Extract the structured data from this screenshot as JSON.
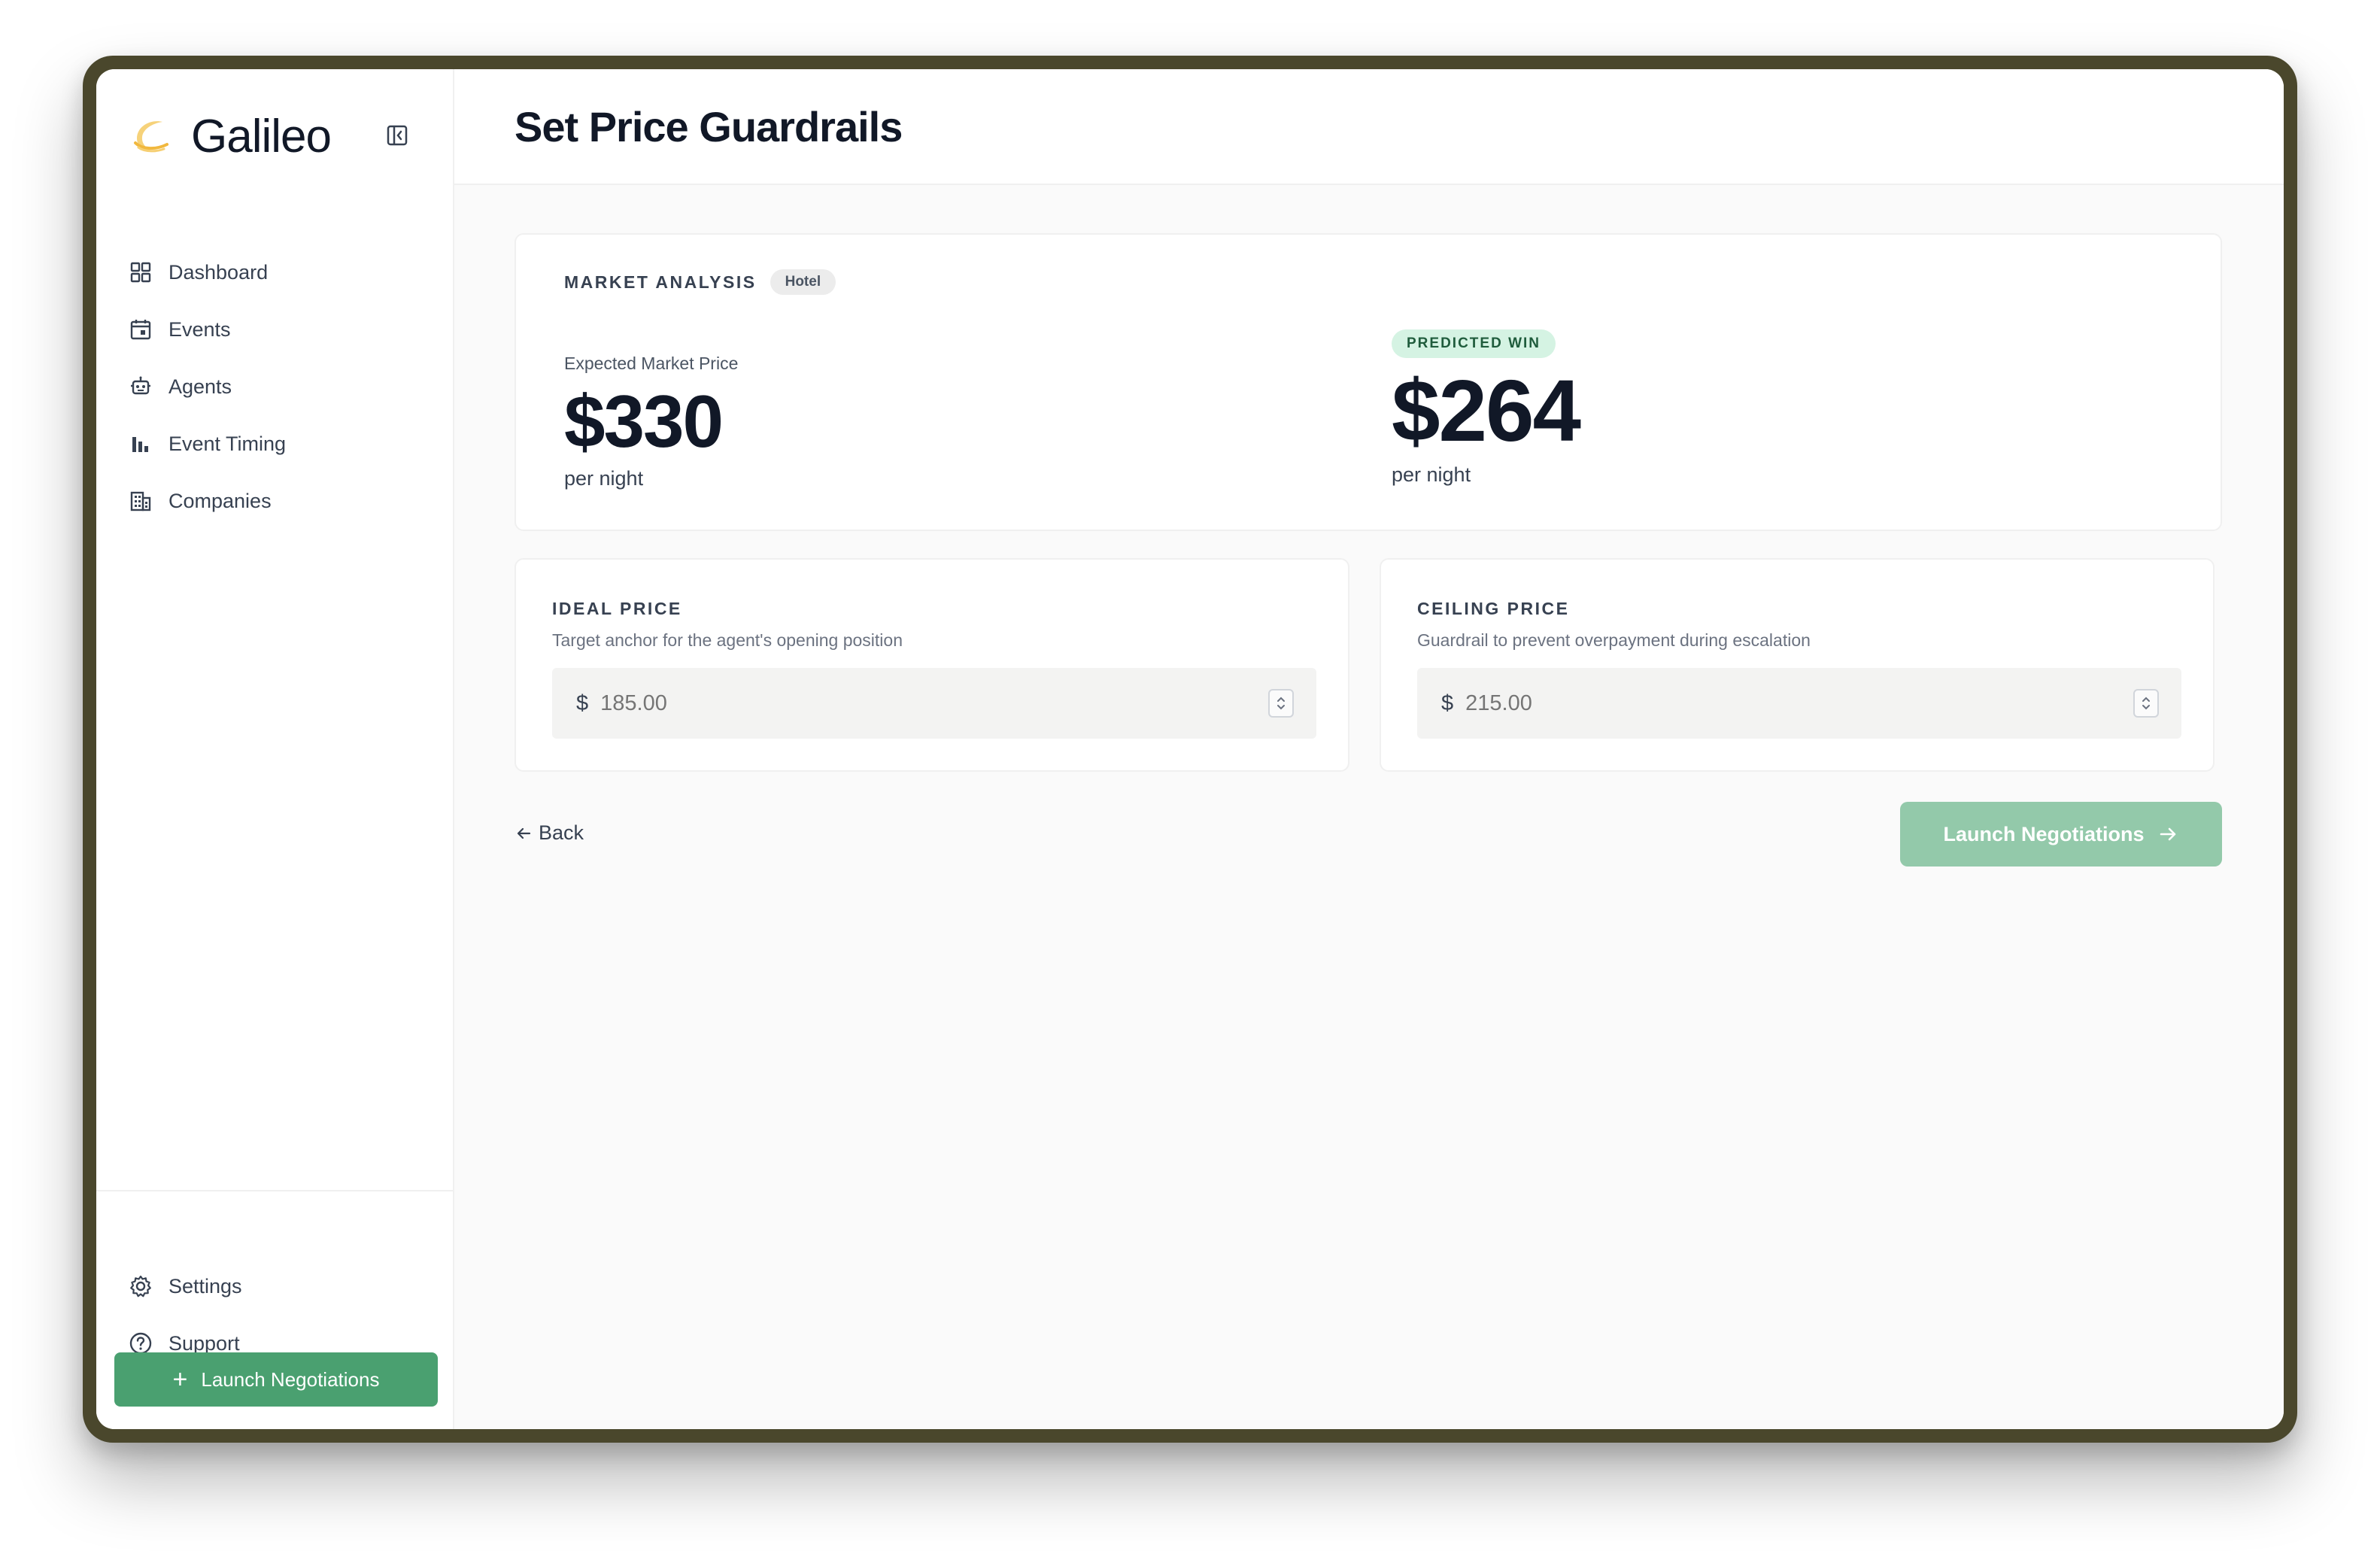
{
  "app": {
    "name": "Galileo"
  },
  "sidebar": {
    "items": [
      {
        "label": "Dashboard",
        "icon": "grid-icon"
      },
      {
        "label": "Events",
        "icon": "calendar-icon"
      },
      {
        "label": "Agents",
        "icon": "robot-icon"
      },
      {
        "label": "Event Timing",
        "icon": "bar-chart-icon"
      },
      {
        "label": "Companies",
        "icon": "building-icon"
      }
    ],
    "bottom_items": [
      {
        "label": "Settings",
        "icon": "gear-icon"
      },
      {
        "label": "Support",
        "icon": "help-circle-icon"
      }
    ],
    "launch_button": "Launch Negotiations"
  },
  "header": {
    "title": "Set Price Guardrails"
  },
  "market": {
    "section_label": "MARKET ANALYSIS",
    "category_badge": "Hotel",
    "expected": {
      "caption": "Expected Market Price",
      "value": "$330",
      "unit": "per night"
    },
    "predicted": {
      "badge": "PREDICTED WIN",
      "value": "$264",
      "unit": "per night"
    }
  },
  "ideal": {
    "title": "IDEAL PRICE",
    "description": "Target anchor for the agent's opening position",
    "currency": "$",
    "placeholder": "185.00"
  },
  "ceiling": {
    "title": "CEILING PRICE",
    "description": "Guardrail to prevent overpayment during escalation",
    "currency": "$",
    "placeholder": "215.00"
  },
  "actions": {
    "back_label": "Back",
    "launch_label": "Launch Negotiations"
  },
  "colors": {
    "accent": "#4aa070",
    "accent_disabled": "#93c9aa",
    "badge_green_bg": "#d5f3e3",
    "badge_green_text": "#1f5c3c",
    "frame": "#4a472c"
  }
}
